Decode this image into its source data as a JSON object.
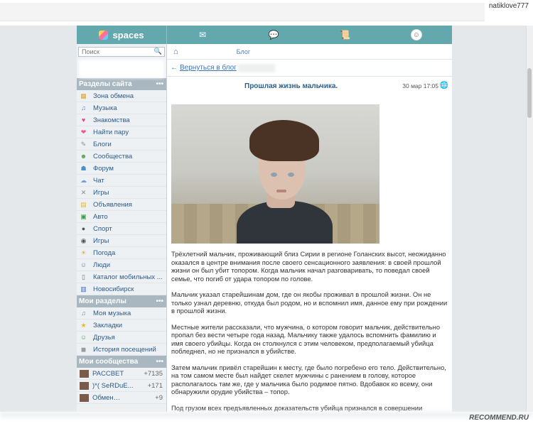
{
  "header": {
    "username": "natiklove777"
  },
  "topnav": {
    "logo": "spaces",
    "tabs": [
      {
        "icon": "mail-icon",
        "glyph": "✉"
      },
      {
        "icon": "chat-icon",
        "glyph": "💬"
      },
      {
        "icon": "journal-icon",
        "glyph": "📜"
      },
      {
        "icon": "profile-avatar",
        "glyph": "☺"
      }
    ]
  },
  "sidebar": {
    "search": {
      "placeholder": "Поиск",
      "icon": "search-icon"
    },
    "sections": [
      {
        "title": "Разделы сайта",
        "items": [
          {
            "label": "Зона обмена",
            "icon": "grid-icon",
            "color": "#d9a441"
          },
          {
            "label": "Музыка",
            "icon": "music-icon",
            "color": "#5a7fd4"
          },
          {
            "label": "Знакомства",
            "icon": "heart-icon",
            "color": "#e0478d"
          },
          {
            "label": "Найти пару",
            "icon": "diamond-heart-icon",
            "color": "#ef5a85"
          },
          {
            "label": "Блоги",
            "icon": "pencil-icon",
            "color": "#8f8f8f"
          },
          {
            "label": "Сообщества",
            "icon": "group-icon",
            "color": "#5aa547"
          },
          {
            "label": "Форум",
            "icon": "forum-icon",
            "color": "#4f8fc2"
          },
          {
            "label": "Чат",
            "icon": "chat-bubble-icon",
            "color": "#69a5dc"
          },
          {
            "label": "Игры",
            "icon": "swords-icon",
            "color": "#888888"
          },
          {
            "label": "Объявления",
            "icon": "notice-icon",
            "color": "#e2b742"
          },
          {
            "label": "Авто",
            "icon": "car-icon",
            "color": "#3b9a48"
          },
          {
            "label": "Спорт",
            "icon": "ball-icon",
            "color": "#555555"
          },
          {
            "label": "Игры",
            "icon": "gamepad-icon",
            "color": "#555555"
          },
          {
            "label": "Погода",
            "icon": "weather-icon",
            "color": "#e9b23b"
          },
          {
            "label": "Люди",
            "icon": "people-icon",
            "color": "#5b86c6"
          },
          {
            "label": "Каталог мобильных ...",
            "icon": "phone-icon",
            "color": "#6f6f6f"
          },
          {
            "label": "Новосибирск",
            "icon": "city-icon",
            "color": "#3f69b5"
          }
        ]
      },
      {
        "title": "Мои разделы",
        "items": [
          {
            "label": "Моя музыка",
            "icon": "music-icon",
            "color": "#6b86d2"
          },
          {
            "label": "Закладки",
            "icon": "star-icon",
            "color": "#e7b72a"
          },
          {
            "label": "Друзья",
            "icon": "friends-icon",
            "color": "#5ba649"
          },
          {
            "label": "История посещений",
            "icon": "footprints-icon",
            "color": "#9c9c9c"
          }
        ]
      },
      {
        "title": "Мои сообщества",
        "items": [
          {
            "label": "PACCBET",
            "count": "+7135"
          },
          {
            "label": ")*( SeRDuE...",
            "count": "+171"
          },
          {
            "label": "Обмен…",
            "count": "+9"
          }
        ]
      }
    ]
  },
  "content": {
    "breadcrumb": {
      "home_icon": "home-icon",
      "label": "Блог"
    },
    "back_link": "Вернуться в блог",
    "post": {
      "title": "Прошлая жизнь мальчика.",
      "date": "30 мар 17:05",
      "paragraphs": [
        "Трёхлетний мальчик, проживающий близ Сирии в регионе Голанских высот, неожиданно оказался в центре внимания после своего сенсационного заявления: в своей прошлой жизни он был убит топором. Когда мальчик начал разговаривать, то поведал своей семье, что погиб от удара топором по голове.",
        "Мальчик указал старейшинам дом, где он якобы проживал в прошлой жизни. Он не только узнал деревню, откуда был родом, но и вспомнил имя, данное ему при рождении в прошлой жизни.",
        "Местные жители рассказали, что мужчина, о котором говорит мальчик, действительно пропал без вести четыре года назад. Мальчику также удалось вспомнить фамилию и имя своего убийцы. Когда он столкнулся с этим человеком, предполагаемый убийца побледнел, но не признался в убийстве.",
        "Затем мальчик привёл старейшин к месту, где было погребено его тело. Действительно, на том самом месте был найдет скелет мужчины с ранением в голову, которое располагалось там же, где у мальчика было родимое пятно. Вдобавок ко всему, они обнаружили орудие убийства – топор.",
        "Под грузом всех предъявленных доказательств убийца признался в совершении"
      ]
    }
  },
  "watermark": "RECOMMEND.RU"
}
